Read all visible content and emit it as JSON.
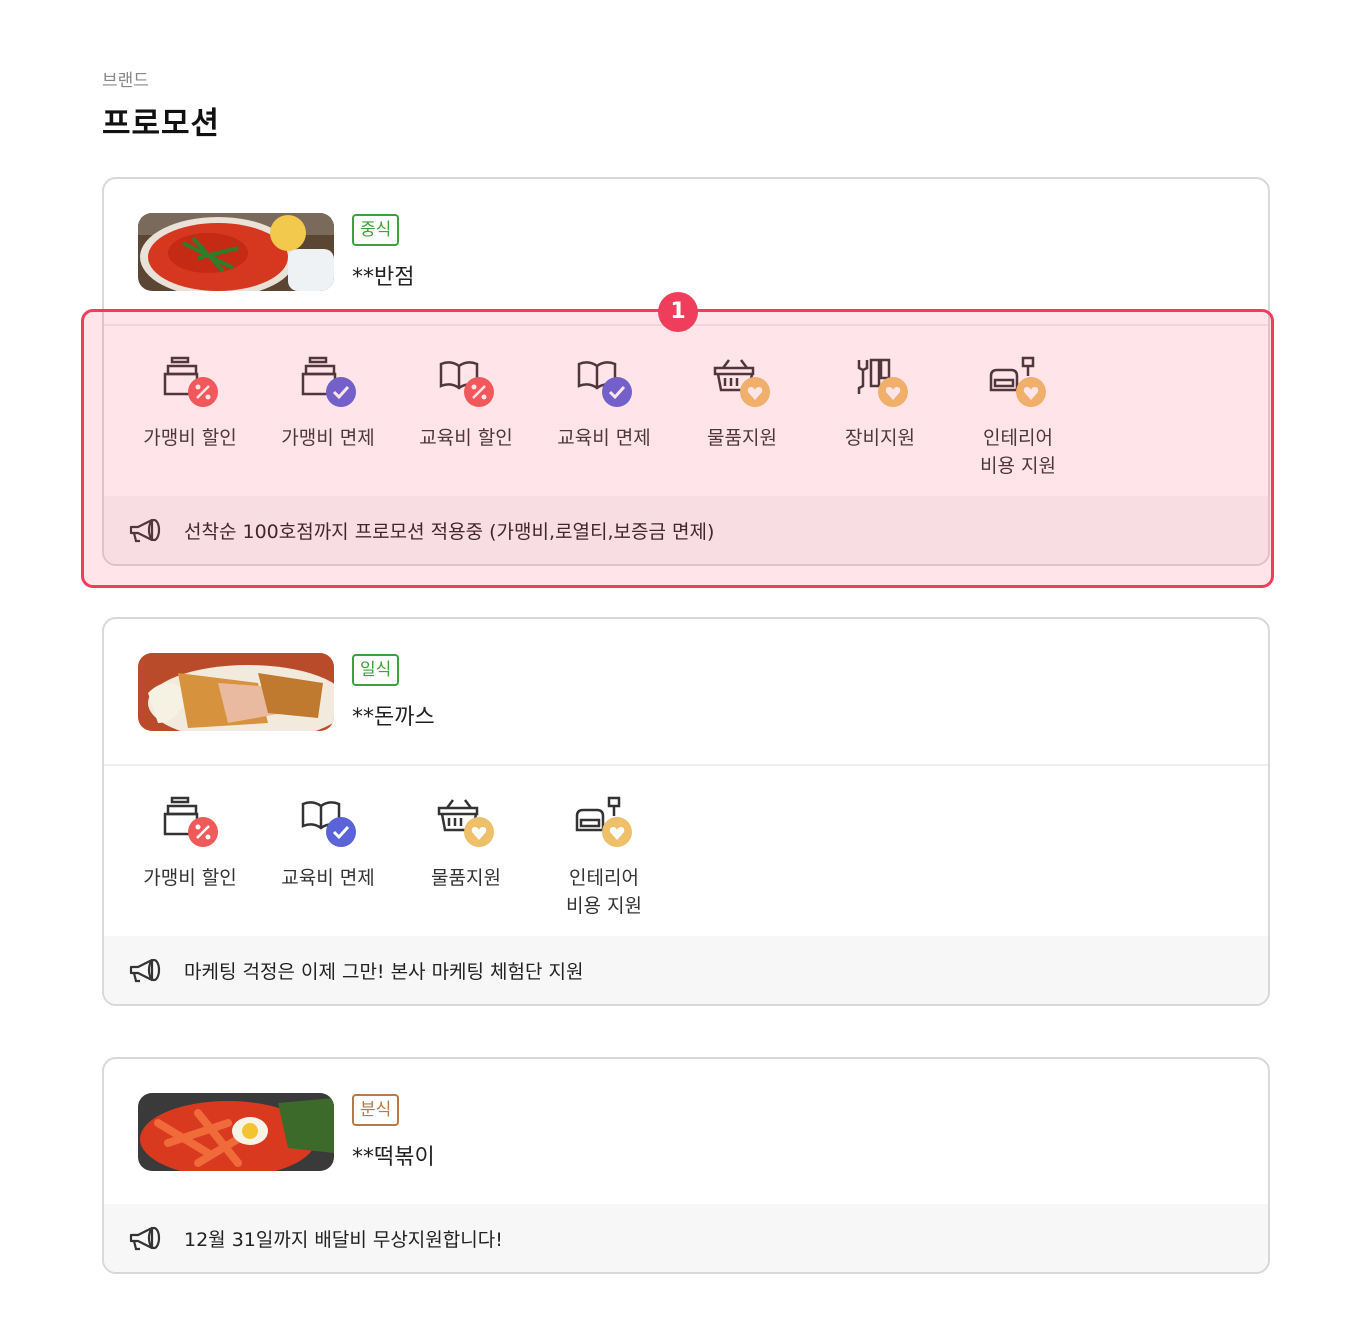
{
  "header": {
    "breadcrumb": "브랜드",
    "title": "프로모션"
  },
  "colors": {
    "badge_green": "#3ca03c",
    "badge_brown": "#b8794a",
    "discount_red": "#ef5a5a",
    "exempt_blue": "#5b63d9",
    "support_gold": "#eec06a",
    "highlight": "#ef3e5c"
  },
  "annotation": {
    "marker": "1"
  },
  "cards": [
    {
      "category": "중식",
      "name": "**반점",
      "image": "jjamppong-photo",
      "benefits": [
        {
          "label": "가맹비 할인",
          "icon": "franchise-fee-discount-icon"
        },
        {
          "label": "가맹비 면제",
          "icon": "franchise-fee-exempt-icon"
        },
        {
          "label": "교육비 할인",
          "icon": "education-fee-discount-icon"
        },
        {
          "label": "교육비 면제",
          "icon": "education-fee-exempt-icon"
        },
        {
          "label": "물품지원",
          "icon": "goods-support-icon"
        },
        {
          "label": "장비지원",
          "icon": "equipment-support-icon"
        },
        {
          "label": "인테리어\n비용 지원",
          "icon": "interior-support-icon"
        }
      ],
      "notice": "선착순 100호점까지 프로모션 적용중 (가맹비,로열티,보증금 면제)"
    },
    {
      "category": "일식",
      "name": "**돈까스",
      "image": "tonkatsu-photo",
      "benefits": [
        {
          "label": "가맹비 할인",
          "icon": "franchise-fee-discount-icon"
        },
        {
          "label": "교육비 면제",
          "icon": "education-fee-exempt-icon"
        },
        {
          "label": "물품지원",
          "icon": "goods-support-icon"
        },
        {
          "label": "인테리어\n비용 지원",
          "icon": "interior-support-icon"
        }
      ],
      "notice": "마케팅 걱정은 이제 그만! 본사 마케팅 체험단 지원"
    },
    {
      "category": "분식",
      "name": "**떡볶이",
      "image": "tteokbokki-photo",
      "benefits": [],
      "notice": "12월 31일까지 배달비 무상지원합니다!"
    }
  ]
}
